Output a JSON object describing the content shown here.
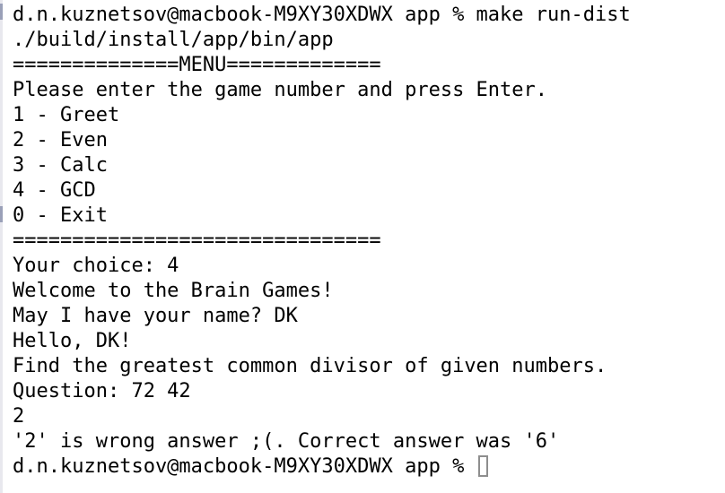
{
  "terminal": {
    "lines": [
      "d.n.kuznetsov@macbook-M9XY30XDWX app % make run-dist",
      "./build/install/app/bin/app",
      "==============MENU=============",
      "Please enter the game number and press Enter.",
      "1 - Greet",
      "2 - Even",
      "3 - Calc",
      "4 - GCD",
      "0 - Exit",
      "===============================",
      "Your choice: 4",
      "Welcome to the Brain Games!",
      "May I have your name? DK",
      "Hello, DK!",
      "Find the greatest common divisor of given numbers.",
      "Question: 72 42",
      "2",
      "'2' is wrong answer ;(. Correct answer was '6'"
    ],
    "prompt": "d.n.kuznetsov@macbook-M9XY30XDWX app % "
  }
}
